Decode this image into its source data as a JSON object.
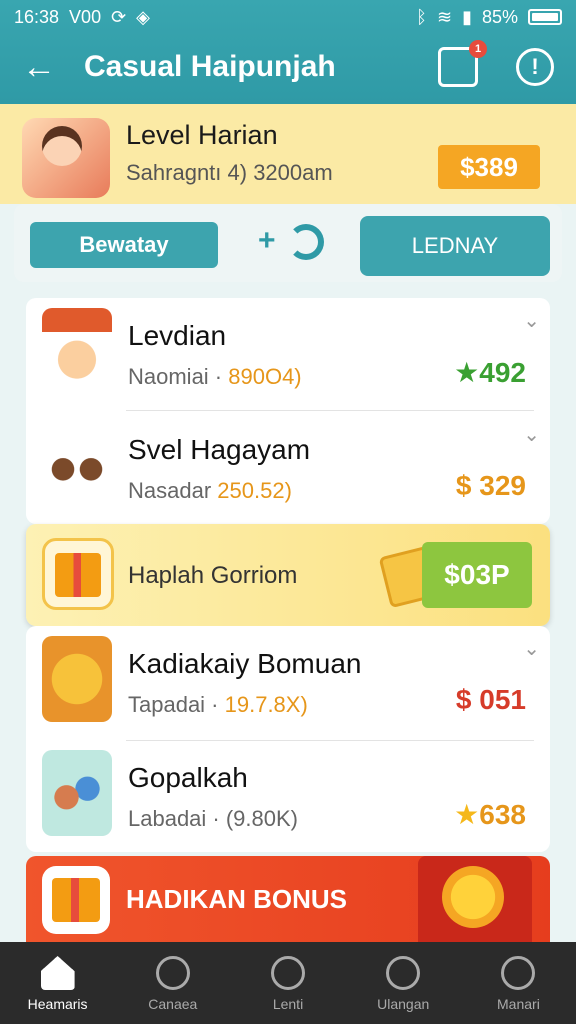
{
  "status": {
    "time": "16:38",
    "carrier": "V00",
    "battery": "85%"
  },
  "header": {
    "title": "Casual Haipunjah",
    "badge_count": "1"
  },
  "level": {
    "title": "Level Harian",
    "subtitle": "Sahragntı 4)  3200am",
    "price": "$389"
  },
  "tabs": {
    "left": "Bewatay",
    "right": "LEDNAY"
  },
  "rows": [
    {
      "name": "Levdian",
      "sub": "Naomiai · ",
      "sub_num": "890O4)",
      "amount": "492",
      "amount_color": "#3aa032"
    },
    {
      "name": "Svel Hagayam",
      "sub": "Nasadar ",
      "sub_num": "250.52)",
      "amount": "$ 329",
      "amount_color": "#e6961a"
    },
    {
      "name": "Kadiakaiy Bomuan",
      "sub": "Tapadai · ",
      "sub_num": "19.7.8X)",
      "amount": "$ 051",
      "amount_color": "#d63c2a"
    },
    {
      "name": "Gopalkah",
      "sub": "Labadai · ",
      "sub_num": "(9.80K)",
      "amount": "638",
      "amount_color": "#e6961a"
    }
  ],
  "gift": {
    "title": "Haplah Gorriom",
    "price": "$03P"
  },
  "bonus": {
    "title": "HADIKAN BONUS"
  },
  "nav": [
    {
      "label": "Heamaris"
    },
    {
      "label": "Canaea"
    },
    {
      "label": "Lenti"
    },
    {
      "label": "Ulangan"
    },
    {
      "label": "Manari"
    }
  ]
}
